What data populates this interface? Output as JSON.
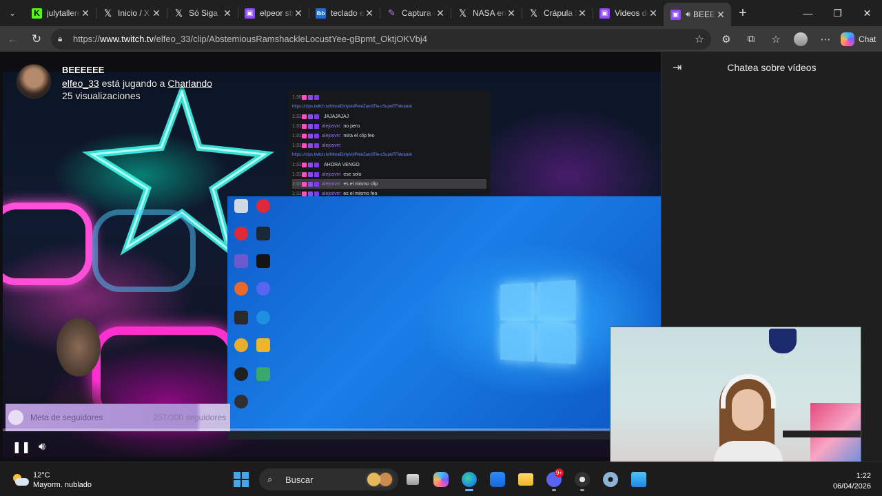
{
  "browser": {
    "tabs": [
      {
        "title": "julytalleres",
        "icon": "kick-icon"
      },
      {
        "title": "Inicio / X",
        "icon": "x-icon"
      },
      {
        "title": "Só Siga",
        "icon": "x-icon"
      },
      {
        "title": "elpeor streamer",
        "icon": "twitch-icon"
      },
      {
        "title": "teclado es",
        "icon": "ibb-icon"
      },
      {
        "title": "Captura de",
        "icon": "pen-icon"
      },
      {
        "title": "NASA en X",
        "icon": "x-icon"
      },
      {
        "title": "Crápula $",
        "icon": "x-icon"
      },
      {
        "title": "Videos de",
        "icon": "twitch-icon"
      },
      {
        "title": "BEEEEEE",
        "icon": "twitch-icon",
        "active": true,
        "audio": true
      }
    ],
    "url_prefix": "https://",
    "url_host": "www.twitch.tv",
    "url_path": "/elfeo_33/clip/AbstemiousRamshackleLocustYee-gBpmt_OktjOKVbj4",
    "chat_button": "Chat"
  },
  "clip": {
    "title": "BEEEEEE",
    "channel": "elfeo_33",
    "playing_text": " está jugando a ",
    "game": "Charlando",
    "views": "25 visualizaciones",
    "follower_goal_label": "Meta de seguidores",
    "follower_goal_count": "257/300 seguidores",
    "follower_goal_fraction": 0.857,
    "progress_fraction": 0.0
  },
  "stream_chat": [
    {
      "ts": "1:30",
      "user": "",
      "text": "",
      "link": "https://clips.twitch.tv/MoralDirtyVolPeteZarollTie-cSupwTFidotatsk",
      "red": true
    },
    {
      "ts": "1:31",
      "user": "",
      "text": "JAJAJAJAJ",
      "red": true
    },
    {
      "ts": "1:31",
      "user": "alejosvrr:",
      "text": "no pero"
    },
    {
      "ts": "1:31",
      "user": "alejosvrr:",
      "text": "mira el clip feo"
    },
    {
      "ts": "1:31",
      "user": "alejosvrr:",
      "text": "",
      "link": "https://clips.twitch.tv/MoralDirtyVolPeteZarollTie-cSupwTFidotatsk"
    },
    {
      "ts": "1:31",
      "user": "",
      "text": "AHORA VENGO",
      "red": true
    },
    {
      "ts": "1:31",
      "user": "alejosvrr:",
      "text": "ese solo"
    },
    {
      "ts": "1:31",
      "user": "alejosvrr:",
      "text": "es el mismo clip",
      "highlight": true
    },
    {
      "ts": "1:31",
      "user": "alejosvrr:",
      "text": "es el mismo feo"
    }
  ],
  "sidebar": {
    "title": "Chatea sobre vídeos"
  },
  "taskbar": {
    "temperature": "12°C",
    "weather": "Mayorm. nublado",
    "search_placeholder": "Buscar",
    "discord_badge": "9+",
    "time": "1:22",
    "date": "06/04/2026"
  },
  "colors": {
    "twitch_purple": "#9146ff",
    "kick_green": "#53fc18",
    "windows_blue": "#1a7ee8"
  }
}
